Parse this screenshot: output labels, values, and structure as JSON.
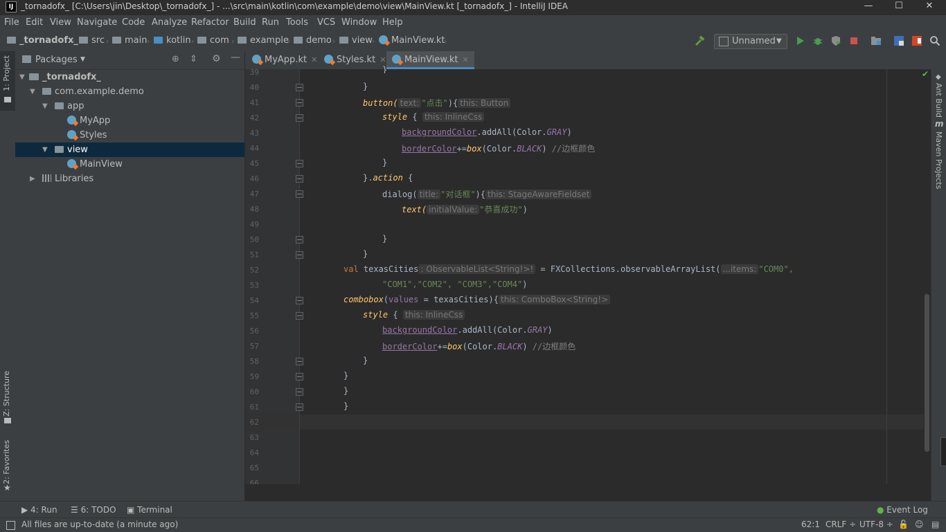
{
  "window": {
    "title": "_tornadofx_ [C:\\Users\\jin\\Desktop\\_tornadofx_] - ...\\src\\main\\kotlin\\com\\example\\demo\\view\\MainView.kt [_tornadofx_] - IntelliJ IDEA",
    "logo": "IJ",
    "minimize": "—",
    "maximize": "☐",
    "close": "✕"
  },
  "menu": [
    "File",
    "Edit",
    "View",
    "Navigate",
    "Code",
    "Analyze",
    "Refactor",
    "Build",
    "Run",
    "Tools",
    "VCS",
    "Window",
    "Help"
  ],
  "breadcrumb": [
    "_tornadofx_",
    "src",
    "main",
    "kotlin",
    "com",
    "example",
    "demo",
    "view",
    "MainView.kt"
  ],
  "toolbar": {
    "run_config": "Unnamed"
  },
  "left_stripe": {
    "project": "1: Project",
    "structure": "Z: Structure",
    "favorites": "2: Favorites"
  },
  "project_panel": {
    "view_mode": "Packages",
    "tree": [
      {
        "label": "_tornadofx_"
      },
      {
        "label": "com.example.demo"
      },
      {
        "label": "app"
      },
      {
        "label": "MyApp"
      },
      {
        "label": "Styles"
      },
      {
        "label": "view"
      },
      {
        "label": "MainView"
      },
      {
        "label": "Libraries"
      }
    ]
  },
  "tabs": [
    {
      "label": "MyApp.kt"
    },
    {
      "label": "Styles.kt"
    },
    {
      "label": "MainView.kt"
    }
  ],
  "editor": {
    "line_numbers": [
      "39",
      "40",
      "41",
      "42",
      "43",
      "44",
      "45",
      "46",
      "47",
      "48",
      "49",
      "50",
      "51",
      "52",
      "53",
      "54",
      "55",
      "56",
      "57",
      "58",
      "59",
      "60",
      "61",
      "62",
      "63",
      "64",
      "65",
      "66"
    ],
    "code": {
      "l39": "}",
      "l40": "}",
      "l41_fn": "button(",
      "l41_hint": "text:",
      "l41_str": "\"点击\"",
      "l41_mid": "){",
      "l41_hint2": "this: Button",
      "l42_kw": "style",
      "l42_mid": " {",
      "l42_hint": "this: InlineCss",
      "l43_prop": "backgroundColor",
      "l43_mid": ".addAll(Color.",
      "l43_const": "GRAY",
      "l43_end": ")",
      "l44_prop": "borderColor",
      "l44_op": "+=",
      "l44_fn": "box",
      "l44_mid": "(Color.",
      "l44_const": "BLACK",
      "l44_end": ")",
      "l44_cmt": "//边框颜色",
      "l45": "}",
      "l46_a": "}.",
      "l46_kw": "action",
      "l46_b": " {",
      "l47_fn": "dialog(",
      "l47_hint": "title:",
      "l47_str": "\"对话框\"",
      "l47_mid": "){",
      "l47_hint2": "this: StageAwareFieldset",
      "l48_fn": "text(",
      "l48_hint": "initialValue:",
      "l48_str": "\"恭喜成功\"",
      "l48_end": ")",
      "l50": "}",
      "l51": "}",
      "l52_kw": "val",
      "l52_name": " texasCities",
      "l52_hint": ": ObservableList<String!>!",
      "l52_mid": " = FXCollections.observableArrayList(",
      "l52_hint2": "...items:",
      "l52_str": "\"COM0\",",
      "l53_str": "\"COM1\",\"COM2\", \"COM3\",\"COM4\"",
      "l53_end": ")",
      "l54_kw": "combobox",
      "l54_paren": "(",
      "l54_param": "values",
      "l54_mid": " = texasCities){",
      "l54_hint": "this: ComboBox<String!>",
      "l55_kw": "style",
      "l55_mid": " {",
      "l55_hint": "this: InlineCss",
      "l56_prop": "backgroundColor",
      "l56_mid": ".addAll(Color.",
      "l56_const": "GRAY",
      "l56_end": ")",
      "l57_prop": "borderColor",
      "l57_op": "+=",
      "l57_fn": "box",
      "l57_mid": "(Color.",
      "l57_const": "BLACK",
      "l57_end": ")",
      "l57_cmt": "//边框颜色",
      "l58": "}",
      "l59": "}",
      "l60": "}",
      "l61": "}"
    }
  },
  "right_stripe": {
    "ant": "Ant Build",
    "maven": "Maven Projects"
  },
  "bottom_tools": {
    "run": "4: Run",
    "todo": "6: TODO",
    "terminal": "Terminal",
    "event_log": "Event Log"
  },
  "status": {
    "message": "All files are up-to-date (a minute ago)",
    "position": "62:1",
    "line_sep": "CRLF ÷",
    "encoding": "UTF-8 ÷"
  },
  "colors": {
    "accent": "#4a88c7",
    "selection": "#0d293e",
    "background": "#2b2b2b"
  }
}
